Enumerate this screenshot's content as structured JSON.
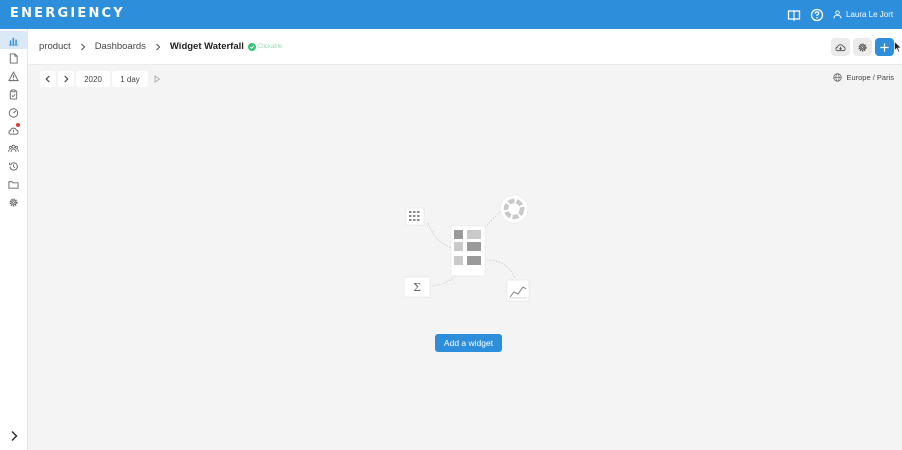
{
  "app": {
    "brand": "ENERGIENCY"
  },
  "topbar": {
    "icons": [
      "book-icon",
      "help-icon",
      "user-icon"
    ],
    "user_name": "Laura Le Jort"
  },
  "sidebar": {
    "items": [
      {
        "icon": "dashboard-chart-icon",
        "active": true
      },
      {
        "icon": "document-icon"
      },
      {
        "icon": "alert-triangle-icon"
      },
      {
        "icon": "clipboard-icon"
      },
      {
        "icon": "gauge-icon"
      },
      {
        "icon": "cloud-alert-icon",
        "has_badge": true
      },
      {
        "icon": "users-icon"
      },
      {
        "icon": "history-icon"
      },
      {
        "icon": "folder-icon"
      },
      {
        "icon": "settings-icon"
      }
    ],
    "expand_icon": "chevron-right-icon"
  },
  "breadcrumb": {
    "items": [
      "product",
      "Dashboards"
    ],
    "current": "Widget Waterfall",
    "status": "Clickable"
  },
  "header_actions": [
    "cloud-download-icon",
    "settings-icon",
    "plus-icon"
  ],
  "toolbar": {
    "year": "2020",
    "period": "1 day",
    "timezone": "Europe / Paris"
  },
  "empty_state": {
    "add_widget_label": "Add a widget"
  },
  "colors": {
    "brand_blue": "#2d8fdc",
    "status_green": "#34c178",
    "alert_red": "#e23b3b"
  }
}
